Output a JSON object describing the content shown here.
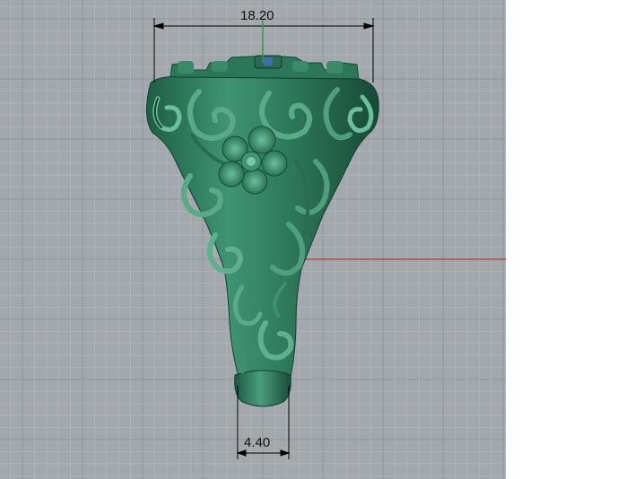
{
  "viewport": {
    "background": "#a3a8ad",
    "grid_minor_color": "#b1b5ba",
    "grid_major_color": "#8f959b",
    "axis_x_color": "#b03a3a",
    "axis_y_color": "#2e9c4a"
  },
  "model": {
    "kind": "carved ring with floral relief",
    "color": "#2f7a5c",
    "highlight_color": "#5fb08f",
    "shadow_color": "#134533",
    "gem_color": "#3b6fae"
  },
  "dimensions": {
    "top_width": "18.20",
    "bottom_width": "4.40"
  }
}
